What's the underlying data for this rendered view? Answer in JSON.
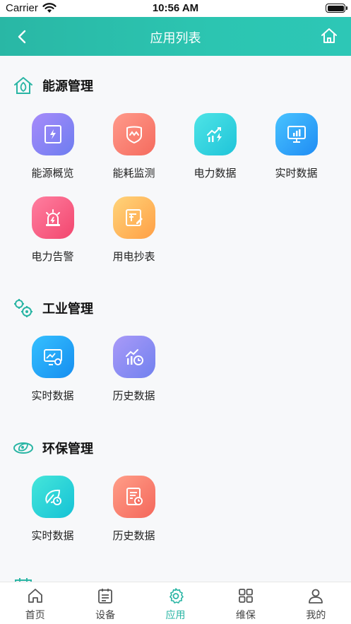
{
  "status": {
    "carrier": "Carrier",
    "time": "10:56 AM"
  },
  "nav": {
    "title": "应用列表"
  },
  "sections": [
    {
      "title": "能源管理",
      "items": [
        {
          "label": "能源概览",
          "icon": "bolt-document-icon"
        },
        {
          "label": "能耗监测",
          "icon": "shield-wave-icon"
        },
        {
          "label": "电力数据",
          "icon": "chart-bolt-icon"
        },
        {
          "label": "实时数据",
          "icon": "monitor-chart-icon"
        },
        {
          "label": "电力告警",
          "icon": "alarm-light-icon"
        },
        {
          "label": "用电抄表",
          "icon": "meter-edit-icon"
        }
      ]
    },
    {
      "title": "工业管理",
      "items": [
        {
          "label": "实时数据",
          "icon": "screen-gear-icon"
        },
        {
          "label": "历史数据",
          "icon": "chart-clock-icon"
        }
      ]
    },
    {
      "title": "环保管理",
      "items": [
        {
          "label": "实时数据",
          "icon": "leaf-clock-icon"
        },
        {
          "label": "历史数据",
          "icon": "document-clock-icon"
        }
      ]
    }
  ],
  "tabs": [
    {
      "label": "首页",
      "icon": "home-icon"
    },
    {
      "label": "设备",
      "icon": "clipboard-icon"
    },
    {
      "label": "应用",
      "icon": "gear-icon",
      "active": true
    },
    {
      "label": "维保",
      "icon": "grid-icon"
    },
    {
      "label": "我的",
      "icon": "user-icon"
    }
  ],
  "colors": {
    "accent": "#2ab5a4",
    "header": "#2cc3b0"
  }
}
